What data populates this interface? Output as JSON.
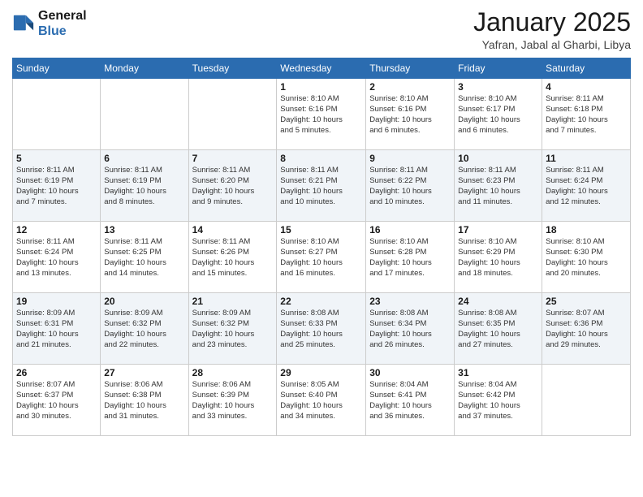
{
  "header": {
    "logo_line1": "General",
    "logo_line2": "Blue",
    "month_title": "January 2025",
    "location": "Yafran, Jabal al Gharbi, Libya"
  },
  "days_of_week": [
    "Sunday",
    "Monday",
    "Tuesday",
    "Wednesday",
    "Thursday",
    "Friday",
    "Saturday"
  ],
  "weeks": [
    [
      {
        "day": "",
        "info": ""
      },
      {
        "day": "",
        "info": ""
      },
      {
        "day": "",
        "info": ""
      },
      {
        "day": "1",
        "info": "Sunrise: 8:10 AM\nSunset: 6:16 PM\nDaylight: 10 hours\nand 5 minutes."
      },
      {
        "day": "2",
        "info": "Sunrise: 8:10 AM\nSunset: 6:16 PM\nDaylight: 10 hours\nand 6 minutes."
      },
      {
        "day": "3",
        "info": "Sunrise: 8:10 AM\nSunset: 6:17 PM\nDaylight: 10 hours\nand 6 minutes."
      },
      {
        "day": "4",
        "info": "Sunrise: 8:11 AM\nSunset: 6:18 PM\nDaylight: 10 hours\nand 7 minutes."
      }
    ],
    [
      {
        "day": "5",
        "info": "Sunrise: 8:11 AM\nSunset: 6:19 PM\nDaylight: 10 hours\nand 7 minutes."
      },
      {
        "day": "6",
        "info": "Sunrise: 8:11 AM\nSunset: 6:19 PM\nDaylight: 10 hours\nand 8 minutes."
      },
      {
        "day": "7",
        "info": "Sunrise: 8:11 AM\nSunset: 6:20 PM\nDaylight: 10 hours\nand 9 minutes."
      },
      {
        "day": "8",
        "info": "Sunrise: 8:11 AM\nSunset: 6:21 PM\nDaylight: 10 hours\nand 10 minutes."
      },
      {
        "day": "9",
        "info": "Sunrise: 8:11 AM\nSunset: 6:22 PM\nDaylight: 10 hours\nand 10 minutes."
      },
      {
        "day": "10",
        "info": "Sunrise: 8:11 AM\nSunset: 6:23 PM\nDaylight: 10 hours\nand 11 minutes."
      },
      {
        "day": "11",
        "info": "Sunrise: 8:11 AM\nSunset: 6:24 PM\nDaylight: 10 hours\nand 12 minutes."
      }
    ],
    [
      {
        "day": "12",
        "info": "Sunrise: 8:11 AM\nSunset: 6:24 PM\nDaylight: 10 hours\nand 13 minutes."
      },
      {
        "day": "13",
        "info": "Sunrise: 8:11 AM\nSunset: 6:25 PM\nDaylight: 10 hours\nand 14 minutes."
      },
      {
        "day": "14",
        "info": "Sunrise: 8:11 AM\nSunset: 6:26 PM\nDaylight: 10 hours\nand 15 minutes."
      },
      {
        "day": "15",
        "info": "Sunrise: 8:10 AM\nSunset: 6:27 PM\nDaylight: 10 hours\nand 16 minutes."
      },
      {
        "day": "16",
        "info": "Sunrise: 8:10 AM\nSunset: 6:28 PM\nDaylight: 10 hours\nand 17 minutes."
      },
      {
        "day": "17",
        "info": "Sunrise: 8:10 AM\nSunset: 6:29 PM\nDaylight: 10 hours\nand 18 minutes."
      },
      {
        "day": "18",
        "info": "Sunrise: 8:10 AM\nSunset: 6:30 PM\nDaylight: 10 hours\nand 20 minutes."
      }
    ],
    [
      {
        "day": "19",
        "info": "Sunrise: 8:09 AM\nSunset: 6:31 PM\nDaylight: 10 hours\nand 21 minutes."
      },
      {
        "day": "20",
        "info": "Sunrise: 8:09 AM\nSunset: 6:32 PM\nDaylight: 10 hours\nand 22 minutes."
      },
      {
        "day": "21",
        "info": "Sunrise: 8:09 AM\nSunset: 6:32 PM\nDaylight: 10 hours\nand 23 minutes."
      },
      {
        "day": "22",
        "info": "Sunrise: 8:08 AM\nSunset: 6:33 PM\nDaylight: 10 hours\nand 25 minutes."
      },
      {
        "day": "23",
        "info": "Sunrise: 8:08 AM\nSunset: 6:34 PM\nDaylight: 10 hours\nand 26 minutes."
      },
      {
        "day": "24",
        "info": "Sunrise: 8:08 AM\nSunset: 6:35 PM\nDaylight: 10 hours\nand 27 minutes."
      },
      {
        "day": "25",
        "info": "Sunrise: 8:07 AM\nSunset: 6:36 PM\nDaylight: 10 hours\nand 29 minutes."
      }
    ],
    [
      {
        "day": "26",
        "info": "Sunrise: 8:07 AM\nSunset: 6:37 PM\nDaylight: 10 hours\nand 30 minutes."
      },
      {
        "day": "27",
        "info": "Sunrise: 8:06 AM\nSunset: 6:38 PM\nDaylight: 10 hours\nand 31 minutes."
      },
      {
        "day": "28",
        "info": "Sunrise: 8:06 AM\nSunset: 6:39 PM\nDaylight: 10 hours\nand 33 minutes."
      },
      {
        "day": "29",
        "info": "Sunrise: 8:05 AM\nSunset: 6:40 PM\nDaylight: 10 hours\nand 34 minutes."
      },
      {
        "day": "30",
        "info": "Sunrise: 8:04 AM\nSunset: 6:41 PM\nDaylight: 10 hours\nand 36 minutes."
      },
      {
        "day": "31",
        "info": "Sunrise: 8:04 AM\nSunset: 6:42 PM\nDaylight: 10 hours\nand 37 minutes."
      },
      {
        "day": "",
        "info": ""
      }
    ]
  ]
}
